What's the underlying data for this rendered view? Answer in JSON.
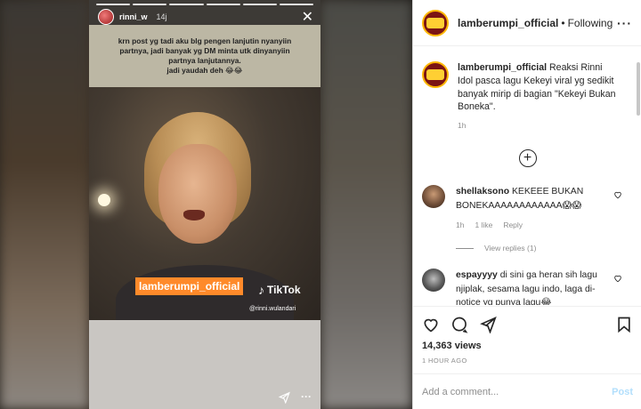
{
  "story": {
    "username": "rinni_w",
    "time": "14j",
    "caption": "krn post yg tadi aku blg pengen lanjutin nyanyiin\npartnya, jadi banyak yg DM minta utk dinyanyiin\npartnya lanjutannya.\njadi yaudah deh 😂😂",
    "watermark": "lamberumpi_official",
    "tiktok_label": "TikTok",
    "tiktok_user": "@rinni.wulandari",
    "close_icon": "close-icon",
    "send_icon": "send-icon",
    "more_icon": "more-icon"
  },
  "header": {
    "username": "lamberumpi_official",
    "separator": "•",
    "follow_status": "Following",
    "menu_label": "···"
  },
  "post": {
    "username": "lamberumpi_official",
    "caption": "Reaksi Rinni Idol pasca lagu Kekeyi viral yg sedikit banyak mirip di bagian \"Kekeyi Bukan Boneka\".",
    "time": "1h",
    "load_more_label": "+"
  },
  "comments": [
    {
      "username": "shellaksono",
      "text": "KEKEEE BUKAN BONEKAAAAAAAAAAAA😱😱",
      "time": "1h",
      "likes": "1 like",
      "reply": "Reply",
      "view_replies": "View replies (1)"
    },
    {
      "username": "espayyyy",
      "text": "di sini ga heran sih lagu njiplak, sesama lagu indo, laga di-notice yg punya lagu😂"
    }
  ],
  "stats": {
    "views": "14,363 views",
    "posted": "1 HOUR AGO"
  },
  "composer": {
    "placeholder": "Add a comment...",
    "post_label": "Post"
  },
  "colors": {
    "link_disabled": "#b2dffc",
    "muted": "#8e8e8e",
    "watermark_bg": "#ff8a2a"
  }
}
